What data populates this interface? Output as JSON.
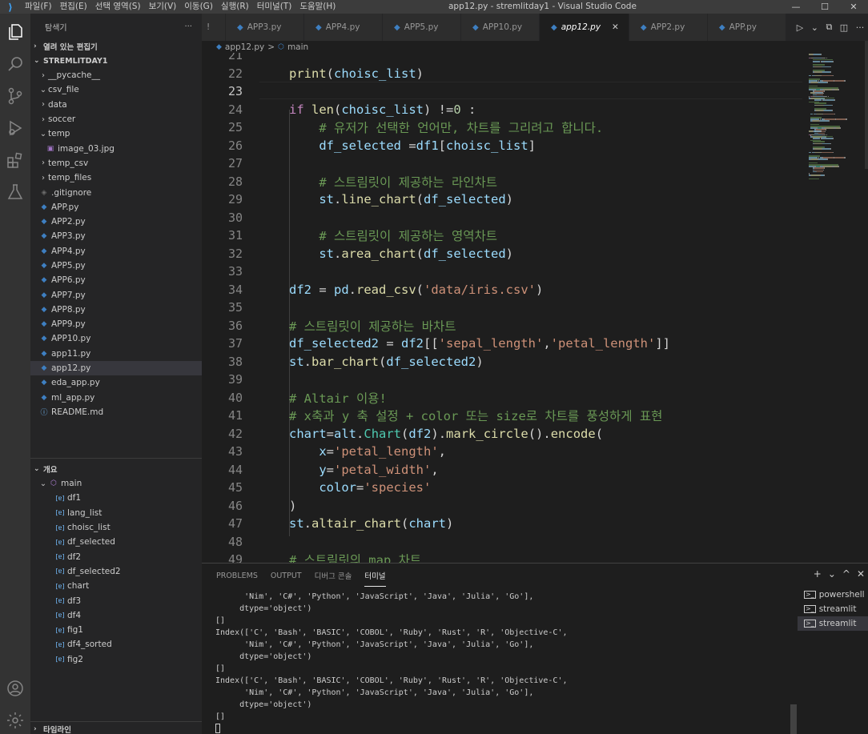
{
  "titlebar": {
    "logo": "⟩",
    "menu": [
      "파일(F)",
      "편집(E)",
      "선택 영역(S)",
      "보기(V)",
      "이동(G)",
      "실행(R)",
      "터미널(T)",
      "도움말(H)"
    ],
    "title": "app12.py - stremlitday1 - Visual Studio Code",
    "minimize": "—",
    "maximize": "☐",
    "close": "✕"
  },
  "sidebar": {
    "title": "탐색기",
    "more": "···",
    "open_editors": "열려 있는 편집기",
    "folder": "STREMLITDAY1",
    "tree": [
      {
        "label": "__pycache__",
        "type": "folder",
        "open": false,
        "depth": 1
      },
      {
        "label": "csv_file",
        "type": "folder",
        "open": true,
        "depth": 1
      },
      {
        "label": "data",
        "type": "folder",
        "open": false,
        "depth": 1
      },
      {
        "label": "soccer",
        "type": "folder",
        "open": false,
        "depth": 1
      },
      {
        "label": "temp",
        "type": "folder",
        "open": true,
        "depth": 1
      },
      {
        "label": "image_03.jpg",
        "type": "image",
        "depth": 2
      },
      {
        "label": "temp_csv",
        "type": "folder",
        "open": false,
        "depth": 1
      },
      {
        "label": "temp_files",
        "type": "folder",
        "open": false,
        "depth": 1
      },
      {
        "label": ".gitignore",
        "type": "git",
        "depth": 1
      },
      {
        "label": "APP.py",
        "type": "py",
        "depth": 1
      },
      {
        "label": "APP2.py",
        "type": "py",
        "depth": 1
      },
      {
        "label": "APP3.py",
        "type": "py",
        "depth": 1
      },
      {
        "label": "APP4.py",
        "type": "py",
        "depth": 1
      },
      {
        "label": "APP5.py",
        "type": "py",
        "depth": 1
      },
      {
        "label": "APP6.py",
        "type": "py",
        "depth": 1
      },
      {
        "label": "APP7.py",
        "type": "py",
        "depth": 1
      },
      {
        "label": "APP8.py",
        "type": "py",
        "depth": 1
      },
      {
        "label": "APP9.py",
        "type": "py",
        "depth": 1
      },
      {
        "label": "APP10.py",
        "type": "py",
        "depth": 1
      },
      {
        "label": "app11.py",
        "type": "py",
        "depth": 1
      },
      {
        "label": "app12.py",
        "type": "py",
        "depth": 1,
        "selected": true
      },
      {
        "label": "eda_app.py",
        "type": "py",
        "depth": 1
      },
      {
        "label": "ml_app.py",
        "type": "py",
        "depth": 1
      },
      {
        "label": "README.md",
        "type": "info",
        "depth": 1
      }
    ],
    "outline_title": "개요",
    "outline_root": "main",
    "outline_items": [
      "df1",
      "lang_list",
      "choisc_list",
      "df_selected",
      "df2",
      "df_selected2",
      "chart",
      "df3",
      "df4",
      "fig1",
      "df4_sorted",
      "fig2"
    ],
    "timeline_title": "타임라인"
  },
  "tabs": [
    {
      "label": "!",
      "partial": true
    },
    {
      "label": "APP3.py"
    },
    {
      "label": "APP4.py"
    },
    {
      "label": "APP5.py"
    },
    {
      "label": "APP10.py"
    },
    {
      "label": "app12.py",
      "active": true
    },
    {
      "label": "APP2.py"
    },
    {
      "label": "APP.py"
    }
  ],
  "tab_close": "✕",
  "tab_actions": [
    "▷",
    "⌄",
    "⧉",
    "◫",
    "···"
  ],
  "breadcrumb": {
    "file": "app12.py",
    "symbol": "main",
    "sep": ">"
  },
  "editor": {
    "current_line": 23,
    "lines": [
      {
        "n": 21,
        "tokens": []
      },
      {
        "n": 22,
        "tokens": [
          [
            "fn",
            "print"
          ],
          [
            "op",
            "("
          ],
          [
            "var",
            "choisc_list"
          ],
          [
            "op",
            ")"
          ]
        ]
      },
      {
        "n": 23,
        "tokens": []
      },
      {
        "n": 24,
        "tokens": [
          [
            "kw",
            "if "
          ],
          [
            "fn",
            "len"
          ],
          [
            "op",
            "("
          ],
          [
            "var",
            "choisc_list"
          ],
          [
            "op",
            ") !="
          ],
          [
            "num",
            "0"
          ],
          [
            "op",
            " :"
          ]
        ]
      },
      {
        "n": 25,
        "tokens": [
          [
            "op",
            "    "
          ],
          [
            "cmt",
            "# 유저가 선택한 언어만, 차트를 그리려고 합니다."
          ]
        ]
      },
      {
        "n": 26,
        "tokens": [
          [
            "op",
            "    "
          ],
          [
            "var",
            "df_selected"
          ],
          [
            "op",
            " ="
          ],
          [
            "var",
            "df1"
          ],
          [
            "op",
            "["
          ],
          [
            "var",
            "choisc_list"
          ],
          [
            "op",
            "]"
          ]
        ]
      },
      {
        "n": 27,
        "tokens": []
      },
      {
        "n": 28,
        "tokens": [
          [
            "op",
            "    "
          ],
          [
            "cmt",
            "# 스트림릿이 제공하는 라인차트"
          ]
        ]
      },
      {
        "n": 29,
        "tokens": [
          [
            "op",
            "    "
          ],
          [
            "var",
            "st"
          ],
          [
            "op",
            "."
          ],
          [
            "fn",
            "line_chart"
          ],
          [
            "op",
            "("
          ],
          [
            "var",
            "df_selected"
          ],
          [
            "op",
            ")"
          ]
        ]
      },
      {
        "n": 30,
        "tokens": []
      },
      {
        "n": 31,
        "tokens": [
          [
            "op",
            "    "
          ],
          [
            "cmt",
            "# 스트림릿이 제공하는 영역차트"
          ]
        ]
      },
      {
        "n": 32,
        "tokens": [
          [
            "op",
            "    "
          ],
          [
            "var",
            "st"
          ],
          [
            "op",
            "."
          ],
          [
            "fn",
            "area_chart"
          ],
          [
            "op",
            "("
          ],
          [
            "var",
            "df_selected"
          ],
          [
            "op",
            ")"
          ]
        ]
      },
      {
        "n": 33,
        "tokens": []
      },
      {
        "n": 34,
        "tokens": [
          [
            "var",
            "df2"
          ],
          [
            "op",
            " = "
          ],
          [
            "var",
            "pd"
          ],
          [
            "op",
            "."
          ],
          [
            "fn",
            "read_csv"
          ],
          [
            "op",
            "("
          ],
          [
            "str",
            "'data/iris.csv'"
          ],
          [
            "op",
            ")"
          ]
        ]
      },
      {
        "n": 35,
        "tokens": []
      },
      {
        "n": 36,
        "tokens": [
          [
            "cmt",
            "# 스트림릿이 제공하는 바차트"
          ]
        ]
      },
      {
        "n": 37,
        "tokens": [
          [
            "var",
            "df_selected2"
          ],
          [
            "op",
            " = "
          ],
          [
            "var",
            "df2"
          ],
          [
            "op",
            "[["
          ],
          [
            "str",
            "'sepal_length'"
          ],
          [
            "op",
            ","
          ],
          [
            "str",
            "'petal_length'"
          ],
          [
            "op",
            "]]"
          ]
        ]
      },
      {
        "n": 38,
        "tokens": [
          [
            "var",
            "st"
          ],
          [
            "op",
            "."
          ],
          [
            "fn",
            "bar_chart"
          ],
          [
            "op",
            "("
          ],
          [
            "var",
            "df_selected2"
          ],
          [
            "op",
            ")"
          ]
        ]
      },
      {
        "n": 39,
        "tokens": []
      },
      {
        "n": 40,
        "tokens": [
          [
            "cmt",
            "# Altair 이용!"
          ]
        ]
      },
      {
        "n": 41,
        "tokens": [
          [
            "cmt",
            "# x축과 y 축 설정 + color 또는 size로 차트를 풍성하게 표현"
          ]
        ]
      },
      {
        "n": 42,
        "tokens": [
          [
            "var",
            "chart"
          ],
          [
            "op",
            "="
          ],
          [
            "var",
            "alt"
          ],
          [
            "op",
            "."
          ],
          [
            "cls",
            "Chart"
          ],
          [
            "op",
            "("
          ],
          [
            "var",
            "df2"
          ],
          [
            "op",
            ")."
          ],
          [
            "fn",
            "mark_circle"
          ],
          [
            "op",
            "()."
          ],
          [
            "fn",
            "encode"
          ],
          [
            "op",
            "("
          ]
        ]
      },
      {
        "n": 43,
        "tokens": [
          [
            "op",
            "    "
          ],
          [
            "var",
            "x"
          ],
          [
            "op",
            "="
          ],
          [
            "str",
            "'petal_length'"
          ],
          [
            "op",
            ","
          ]
        ]
      },
      {
        "n": 44,
        "tokens": [
          [
            "op",
            "    "
          ],
          [
            "var",
            "y"
          ],
          [
            "op",
            "="
          ],
          [
            "str",
            "'petal_width'"
          ],
          [
            "op",
            ","
          ]
        ]
      },
      {
        "n": 45,
        "tokens": [
          [
            "op",
            "    "
          ],
          [
            "var",
            "color"
          ],
          [
            "op",
            "="
          ],
          [
            "str",
            "'species'"
          ]
        ]
      },
      {
        "n": 46,
        "tokens": [
          [
            "op",
            ")"
          ]
        ]
      },
      {
        "n": 47,
        "tokens": [
          [
            "var",
            "st"
          ],
          [
            "op",
            "."
          ],
          [
            "fn",
            "altair_chart"
          ],
          [
            "op",
            "("
          ],
          [
            "var",
            "chart"
          ],
          [
            "op",
            ")"
          ]
        ]
      },
      {
        "n": 48,
        "tokens": []
      },
      {
        "n": 49,
        "tokens": [
          [
            "cmt",
            "# 스트림릿의 map 차트"
          ]
        ]
      }
    ]
  },
  "panel": {
    "tabs": [
      "PROBLEMS",
      "OUTPUT",
      "디버그 콘솔",
      "터미널"
    ],
    "active_tab": "터미널",
    "actions": [
      "+",
      "⌄",
      "^",
      "✕"
    ],
    "terminal_lines": [
      "      'Nim', 'C#', 'Python', 'JavaScript', 'Java', 'Julia', 'Go'],",
      "     dtype='object')",
      "[]",
      "Index(['C', 'Bash', 'BASIC', 'COBOL', 'Ruby', 'Rust', 'R', 'Objective-C',",
      "      'Nim', 'C#', 'Python', 'JavaScript', 'Java', 'Julia', 'Go'],",
      "     dtype='object')",
      "[]",
      "Index(['C', 'Bash', 'BASIC', 'COBOL', 'Ruby', 'Rust', 'R', 'Objective-C',",
      "      'Nim', 'C#', 'Python', 'JavaScript', 'Java', 'Julia', 'Go'],",
      "     dtype='object')",
      "[]"
    ],
    "terminals": [
      {
        "label": "powershell",
        "selected": false
      },
      {
        "label": "streamlit",
        "selected": false
      },
      {
        "label": "streamlit",
        "selected": true
      }
    ]
  }
}
